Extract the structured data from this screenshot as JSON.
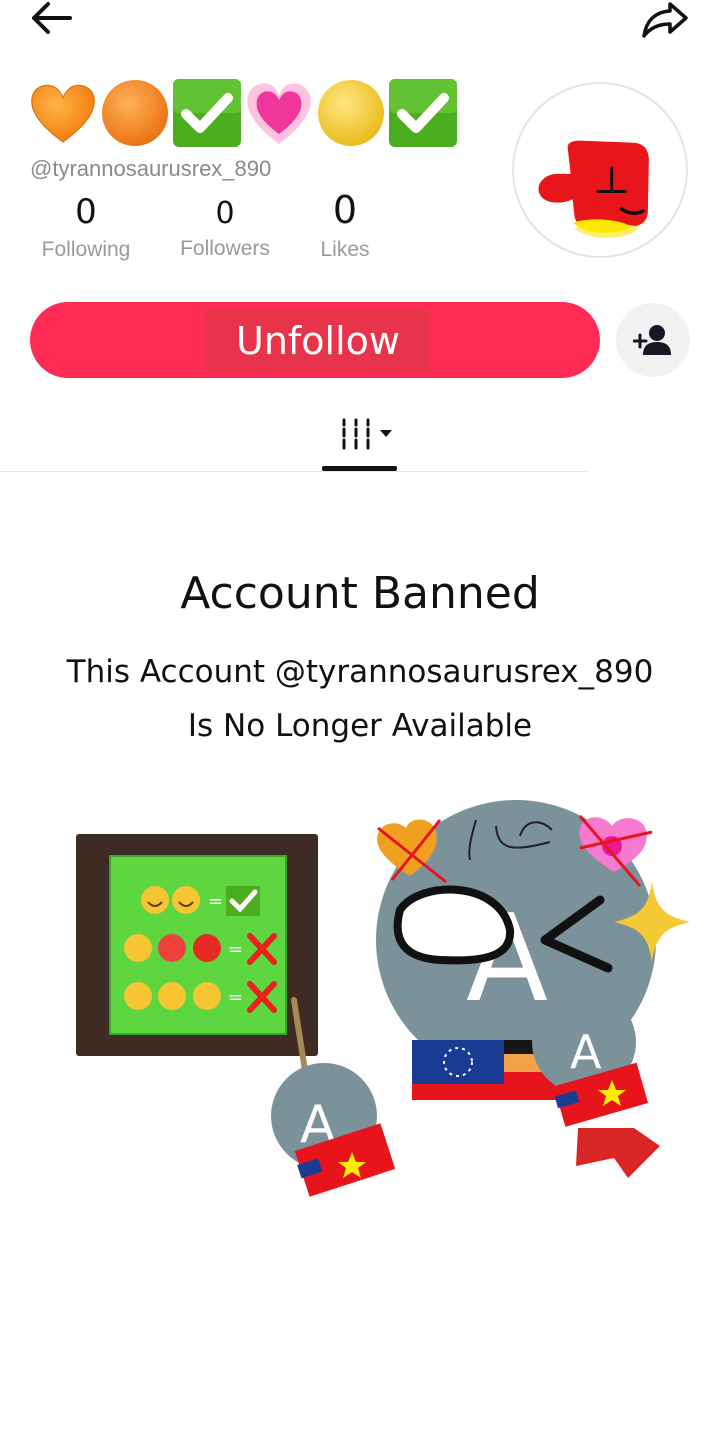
{
  "header": {
    "back_icon": "arrow-left-icon",
    "share_icon": "share-arrow-icon"
  },
  "profile": {
    "name_emojis": [
      "orange-heart",
      "orange-circle",
      "check-mark-button",
      "growing-heart",
      "yellow-circle",
      "check-mark-button"
    ],
    "handle": "@tyrannosaurusrex_890",
    "stats": [
      {
        "value": "0",
        "label": "Following"
      },
      {
        "value": "0",
        "label": "Followers"
      },
      {
        "value": "0",
        "label": "Likes"
      }
    ],
    "avatar_icon": "red-blob-avatar"
  },
  "actions": {
    "unfollow_label": "Unfollow",
    "add_friend_icon": "add-person-icon",
    "accent_color": "#fe2c55"
  },
  "tabs": {
    "grid_icon": "grid-dropdown-icon"
  },
  "banned": {
    "title": "Account Banned",
    "line1": "This Account @tyrannosaurusrex_890",
    "line2": "Is No Longer Available"
  },
  "illustration": {
    "letter": "A"
  }
}
